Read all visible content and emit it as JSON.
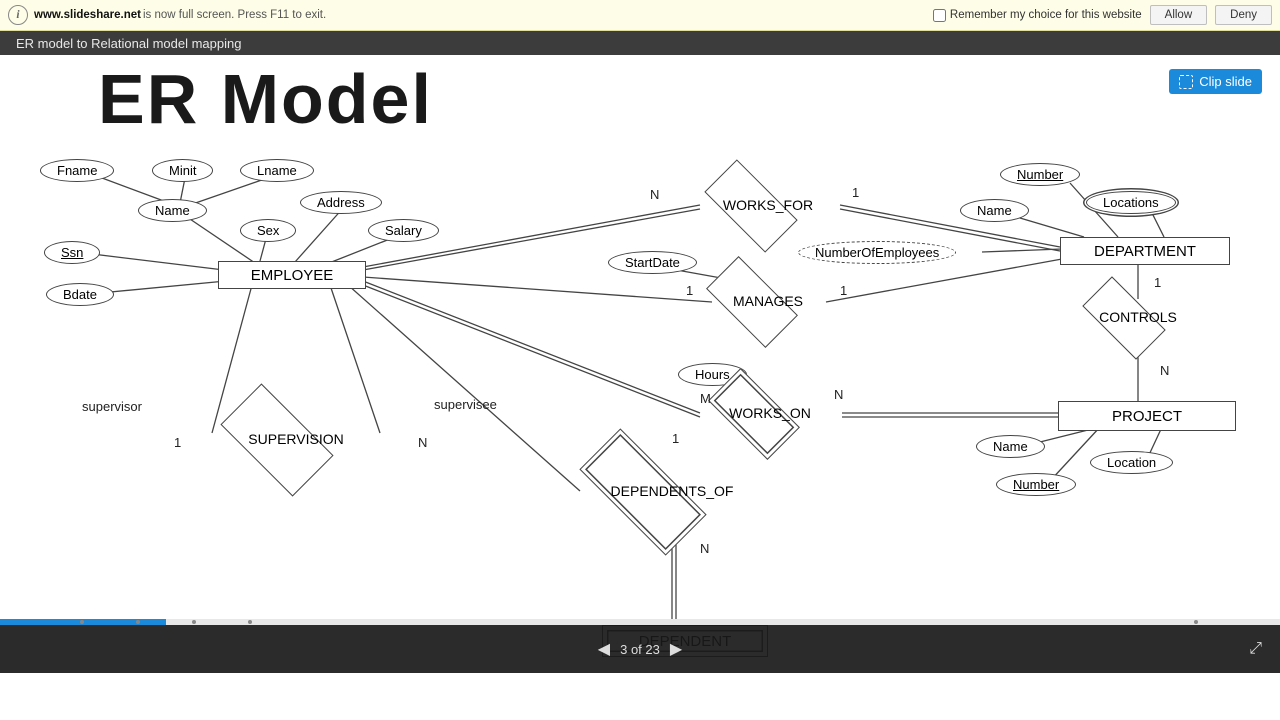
{
  "topbar": {
    "site": "www.slideshare.net",
    "msg": " is now full screen. Press F11 to exit.",
    "remember_label": "Remember my choice for this website",
    "allow_label": "Allow",
    "deny_label": "Deny"
  },
  "titlebar": {
    "title": "ER model to Relational model mapping"
  },
  "clip": {
    "label": "Clip slide"
  },
  "slide": {
    "title": "ER Model",
    "entities": {
      "employee": "EMPLOYEE",
      "department": "DEPARTMENT",
      "project": "PROJECT",
      "dependent": "DEPENDENT"
    },
    "attributes": {
      "fname": "Fname",
      "minit": "Minit",
      "lname": "Lname",
      "name1": "Name",
      "address": "Address",
      "sex": "Sex",
      "salary": "Salary",
      "ssn": "Ssn",
      "bdate": "Bdate",
      "startdate": "StartDate",
      "numemp": "NumberOfEmployees",
      "hours": "Hours",
      "dept_number": "Number",
      "dept_name": "Name",
      "dept_loc": "Locations",
      "proj_name": "Name",
      "proj_loc": "Location",
      "proj_number": "Number"
    },
    "relationships": {
      "works_for": "WORKS_FOR",
      "manages": "MANAGES",
      "supervision": "SUPERVISION",
      "works_on": "WORKS_ON",
      "dependents_of": "DEPENDENTS_OF",
      "controls": "CONTROLS"
    },
    "labels": {
      "supervisor": "supervisor",
      "supervisee": "supervisee",
      "n": "N",
      "one": "1",
      "m": "M"
    }
  },
  "nav": {
    "page_label": "3 of 23",
    "current": 3,
    "total": 23
  }
}
